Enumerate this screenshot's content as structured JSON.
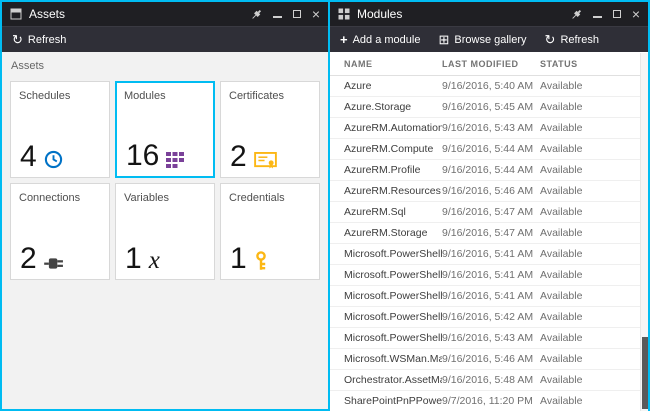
{
  "colors": {
    "accent": "#00bcf2",
    "header_bg": "#1f1f23",
    "toolbar_bg": "#2f2f37",
    "clock_icon": "#0072c6",
    "modules_icon": "#7a4199",
    "gold_icon": "#fcb714",
    "plug_icon": "#444444"
  },
  "icons": {
    "refresh": "↻",
    "add": "+",
    "browse_gallery": "⊞",
    "close": "×"
  },
  "left_blade": {
    "title": "Assets",
    "toolbar": {
      "refresh": "Refresh"
    },
    "section_label": "Assets",
    "tiles": [
      {
        "label": "Schedules",
        "count": "4",
        "icon": "clock-icon",
        "selected": false
      },
      {
        "label": "Modules",
        "count": "16",
        "icon": "modules-icon",
        "selected": true
      },
      {
        "label": "Certificates",
        "count": "2",
        "icon": "certificate-icon",
        "selected": false
      },
      {
        "label": "Connections",
        "count": "2",
        "icon": "plug-icon",
        "selected": false
      },
      {
        "label": "Variables",
        "count": "1",
        "icon": "variable-x-icon",
        "selected": false
      },
      {
        "label": "Credentials",
        "count": "1",
        "icon": "key-icon",
        "selected": false
      }
    ]
  },
  "right_blade": {
    "title": "Modules",
    "toolbar": {
      "add": "Add a module",
      "browse": "Browse gallery",
      "refresh": "Refresh"
    },
    "table": {
      "columns": [
        "NAME",
        "LAST MODIFIED",
        "STATUS"
      ],
      "rows": [
        {
          "name": "Azure",
          "modified": "9/16/2016, 5:40 AM",
          "status": "Available"
        },
        {
          "name": "Azure.Storage",
          "modified": "9/16/2016, 5:45 AM",
          "status": "Available"
        },
        {
          "name": "AzureRM.Automation",
          "modified": "9/16/2016, 5:43 AM",
          "status": "Available"
        },
        {
          "name": "AzureRM.Compute",
          "modified": "9/16/2016, 5:44 AM",
          "status": "Available"
        },
        {
          "name": "AzureRM.Profile",
          "modified": "9/16/2016, 5:44 AM",
          "status": "Available"
        },
        {
          "name": "AzureRM.Resources",
          "modified": "9/16/2016, 5:46 AM",
          "status": "Available"
        },
        {
          "name": "AzureRM.Sql",
          "modified": "9/16/2016, 5:47 AM",
          "status": "Available"
        },
        {
          "name": "AzureRM.Storage",
          "modified": "9/16/2016, 5:47 AM",
          "status": "Available"
        },
        {
          "name": "Microsoft.PowerShell.Core",
          "modified": "9/16/2016, 5:41 AM",
          "status": "Available"
        },
        {
          "name": "Microsoft.PowerShell.Diagnost...",
          "modified": "9/16/2016, 5:41 AM",
          "status": "Available"
        },
        {
          "name": "Microsoft.PowerShell.Manage...",
          "modified": "9/16/2016, 5:41 AM",
          "status": "Available"
        },
        {
          "name": "Microsoft.PowerShell.Security",
          "modified": "9/16/2016, 5:42 AM",
          "status": "Available"
        },
        {
          "name": "Microsoft.PowerShell.Utility",
          "modified": "9/16/2016, 5:43 AM",
          "status": "Available"
        },
        {
          "name": "Microsoft.WSMan.Management",
          "modified": "9/16/2016, 5:46 AM",
          "status": "Available"
        },
        {
          "name": "Orchestrator.AssetManageme...",
          "modified": "9/16/2016, 5:48 AM",
          "status": "Available"
        },
        {
          "name": "SharePointPnPPowerShellOnline",
          "modified": "9/7/2016, 11:20 PM",
          "status": "Available"
        }
      ]
    }
  }
}
